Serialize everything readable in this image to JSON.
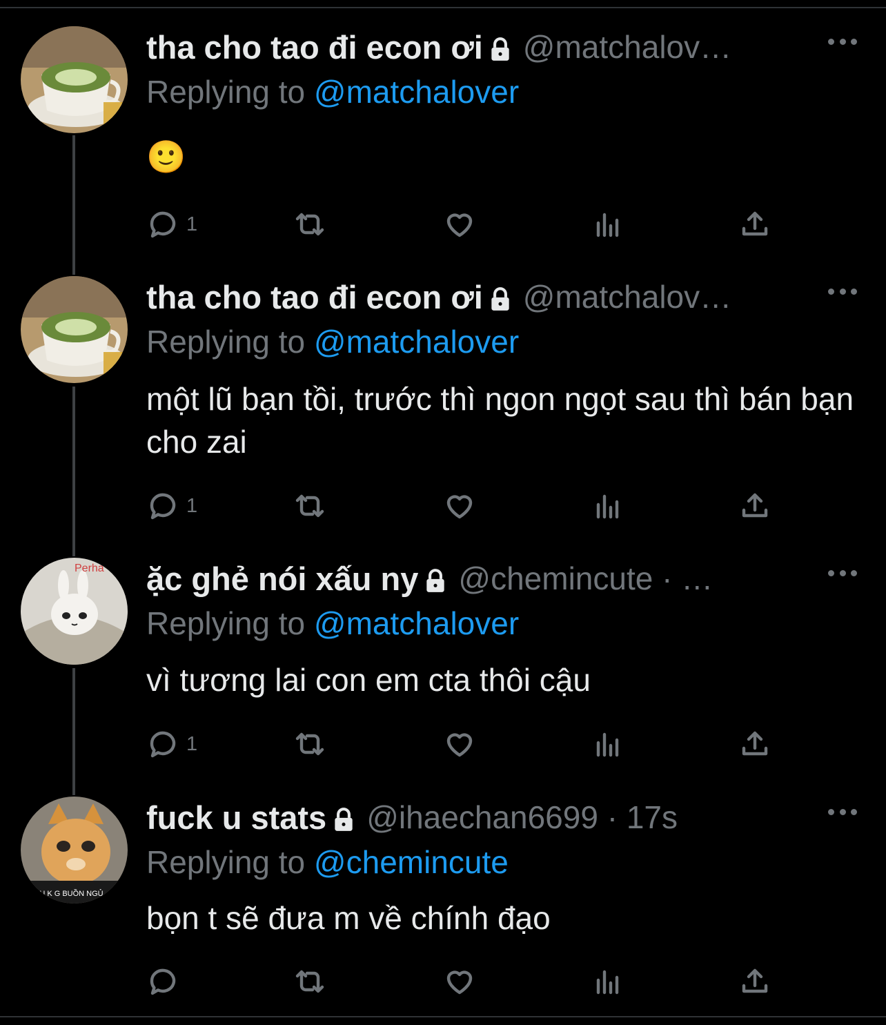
{
  "tweets": [
    {
      "name": "tha cho tao đi econ ơi",
      "handle": "@matchalov…",
      "replying_prefix": "Replying to ",
      "replying_to": "@matchalover",
      "text": "🙂",
      "reply_count": "1",
      "avatar": "matcha-latte"
    },
    {
      "name": "tha cho tao đi econ ơi",
      "handle": "@matchalov…",
      "replying_prefix": "Replying to ",
      "replying_to": "@matchalover",
      "text": "một lũ bạn tồi, trước thì ngon ngọt sau thì bán bạn cho zai",
      "reply_count": "1",
      "avatar": "matcha-latte"
    },
    {
      "name": "ặc ghẻ nói xấu ny",
      "handle": "@chemincute · …",
      "replying_prefix": "Replying to ",
      "replying_to": "@matchalover",
      "text": "vì tương lai con em cta thôi cậu",
      "reply_count": "1",
      "avatar": "plush-bunny"
    },
    {
      "name": "fuck u stats",
      "handle": "@ihaechan6699 · 17s",
      "replying_prefix": "Replying to ",
      "replying_to": "@chemincute",
      "text": "bọn t sẽ đưa m về chính đạo",
      "reply_count": "",
      "avatar": "orange-cat"
    }
  ],
  "avatar_texts": {
    "bunny": "Perha",
    "cat": "AU K   G BUỒN NGỦ"
  },
  "colors": {
    "background": "#000000",
    "text": "#e7e9ea",
    "muted": "#71767b",
    "mention": "#1d9bf0",
    "thread_line": "#3e4144"
  }
}
